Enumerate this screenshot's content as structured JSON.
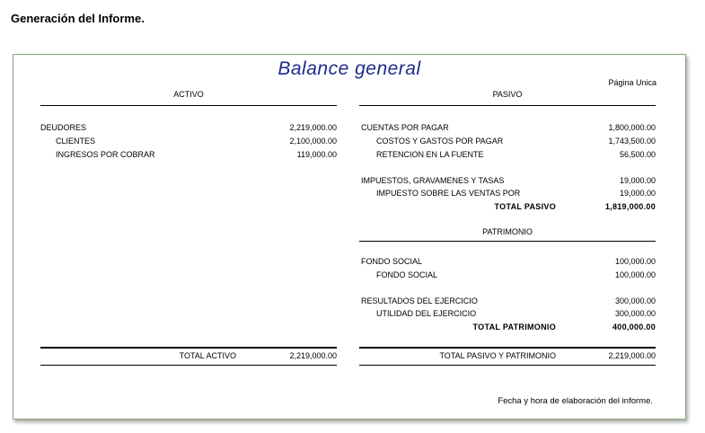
{
  "heading": "Generación del Informe.",
  "report": {
    "title": "Balance general",
    "page_label": "Página Unica",
    "activo": {
      "header": "ACTIVO",
      "rows": [
        {
          "label": "DEUDORES",
          "amount": "2,219,000.00"
        },
        {
          "label": "CLIENTES",
          "amount": "2,100,000.00"
        },
        {
          "label": "INGRESOS POR COBRAR",
          "amount": "119,000.00"
        }
      ],
      "total_label": "TOTAL ACTIVO",
      "total_amount": "2,219,000.00"
    },
    "pasivo": {
      "header": "PASIVO",
      "rows": [
        {
          "label": "CUENTAS POR PAGAR",
          "amount": "1,800,000.00"
        },
        {
          "label": "COSTOS Y GASTOS POR PAGAR",
          "amount": "1,743,500.00"
        },
        {
          "label": "RETENCION EN LA FUENTE",
          "amount": "56,500.00"
        },
        {
          "label": "IMPUESTOS, GRAVAMENES Y TASAS",
          "amount": "19,000.00"
        },
        {
          "label": "IMPUESTO SOBRE LAS VENTAS POR",
          "amount": "19,000.00"
        }
      ],
      "total_label": "TOTAL PASIVO",
      "total_amount": "1,819,000.00"
    },
    "patrimonio": {
      "header": "PATRIMONIO",
      "rows": [
        {
          "label": "FONDO SOCIAL",
          "amount": "100,000.00"
        },
        {
          "label": "FONDO SOCIAL",
          "amount": "100,000.00"
        },
        {
          "label": "RESULTADOS DEL EJERCICIO",
          "amount": "300,000.00"
        },
        {
          "label": "UTILIDAD DEL EJERCICIO",
          "amount": "300,000.00"
        }
      ],
      "total_label": "TOTAL PATRIMONIO",
      "total_amount": "400,000.00"
    },
    "grand_total_label": "TOTAL PASIVO Y PATRIMONIO",
    "grand_total_amount": "2,219,000.00",
    "footer": "Fecha y hora de elaboración del informe."
  }
}
